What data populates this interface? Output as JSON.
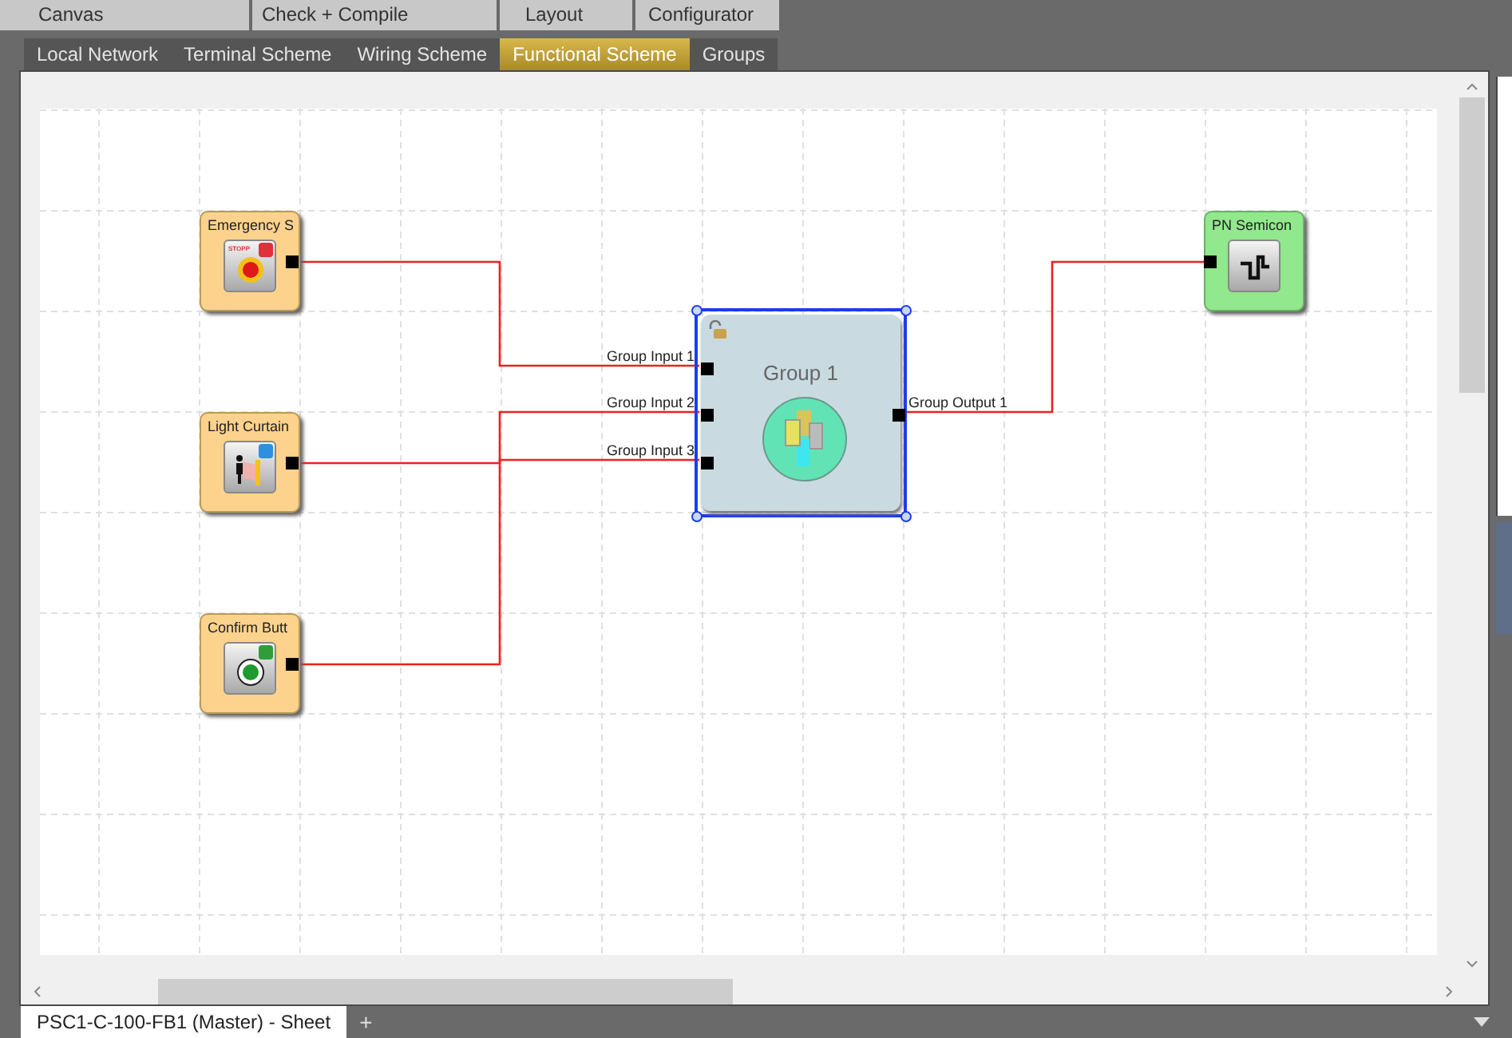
{
  "menu_tabs": [
    "Canvas",
    "Check + Compile",
    "Layout",
    "Configurator"
  ],
  "view_tabs": [
    {
      "label": "Local Network",
      "selected": false
    },
    {
      "label": "Terminal Scheme",
      "selected": false
    },
    {
      "label": "Wiring Scheme",
      "selected": false
    },
    {
      "label": "Functional Scheme",
      "selected": true
    },
    {
      "label": "Groups",
      "selected": false
    }
  ],
  "canvas": {
    "nodes": [
      {
        "kind": "input",
        "title": "Emergency S",
        "color": "#e0303a",
        "icon_text": "STOPP"
      },
      {
        "kind": "input",
        "title": "Light Curtain",
        "color": "#2e8fe0"
      },
      {
        "kind": "input",
        "title": "Confirm Butt",
        "color": "#2f9e3a"
      },
      {
        "kind": "group",
        "title": "Group 1",
        "selected": true,
        "locked": false,
        "inputs": [
          "Group Input 1",
          "Group Input 2",
          "Group Input 3"
        ],
        "outputs": [
          "Group Output 1"
        ]
      },
      {
        "kind": "output",
        "title": "PN Semicon"
      }
    ]
  },
  "sheet_tabs": [
    {
      "label": "PSC1-C-100-FB1 (Master) - Sheet",
      "selected": true
    }
  ],
  "add_sheet": "+"
}
